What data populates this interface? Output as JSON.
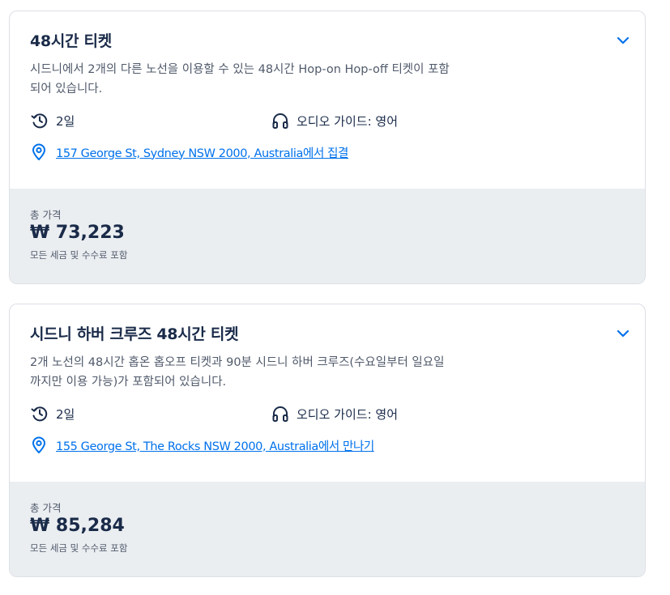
{
  "cards": [
    {
      "title": "48시간 티켓",
      "description": "시드니에서 2개의 다른 노선을 이용할 수 있는 48시간 Hop-on Hop-off 티켓이 포함되어 있습니다.",
      "duration": "2일",
      "audio_guide": "오디오 가이드: 영어",
      "meeting_address": "157 George St, Sydney NSW 2000, Australia",
      "meeting_suffix": "에서 집결",
      "price_label": "총 가격",
      "price": "₩ 73,223",
      "price_note": "모든 세금 및 수수료 포함"
    },
    {
      "title": "시드니 하버 크루즈 48시간 티켓",
      "description": "2개 노선의 48시간 홉온 홉오프 티켓과 90분 시드니 하버 크루즈(수요일부터 일요일까지만 이용 가능)가 포함되어 있습니다.",
      "duration": "2일",
      "audio_guide": "오디오 가이드: 영어",
      "meeting_address": "155 George St, The Rocks NSW 2000, Australia",
      "meeting_suffix": "에서 만나기",
      "price_label": "총 가격",
      "price": "₩ 85,284",
      "price_note": "모든 세금 및 수수료 포함"
    }
  ],
  "icons": {
    "expand": "chevron-down-icon",
    "duration": "clock-history-icon",
    "audio": "headphones-icon",
    "location": "location-pin-icon"
  },
  "colors": {
    "link": "#0071eb",
    "text": "#1a2b49",
    "muted": "#505a6b",
    "price_panel": "#ebeef1"
  }
}
